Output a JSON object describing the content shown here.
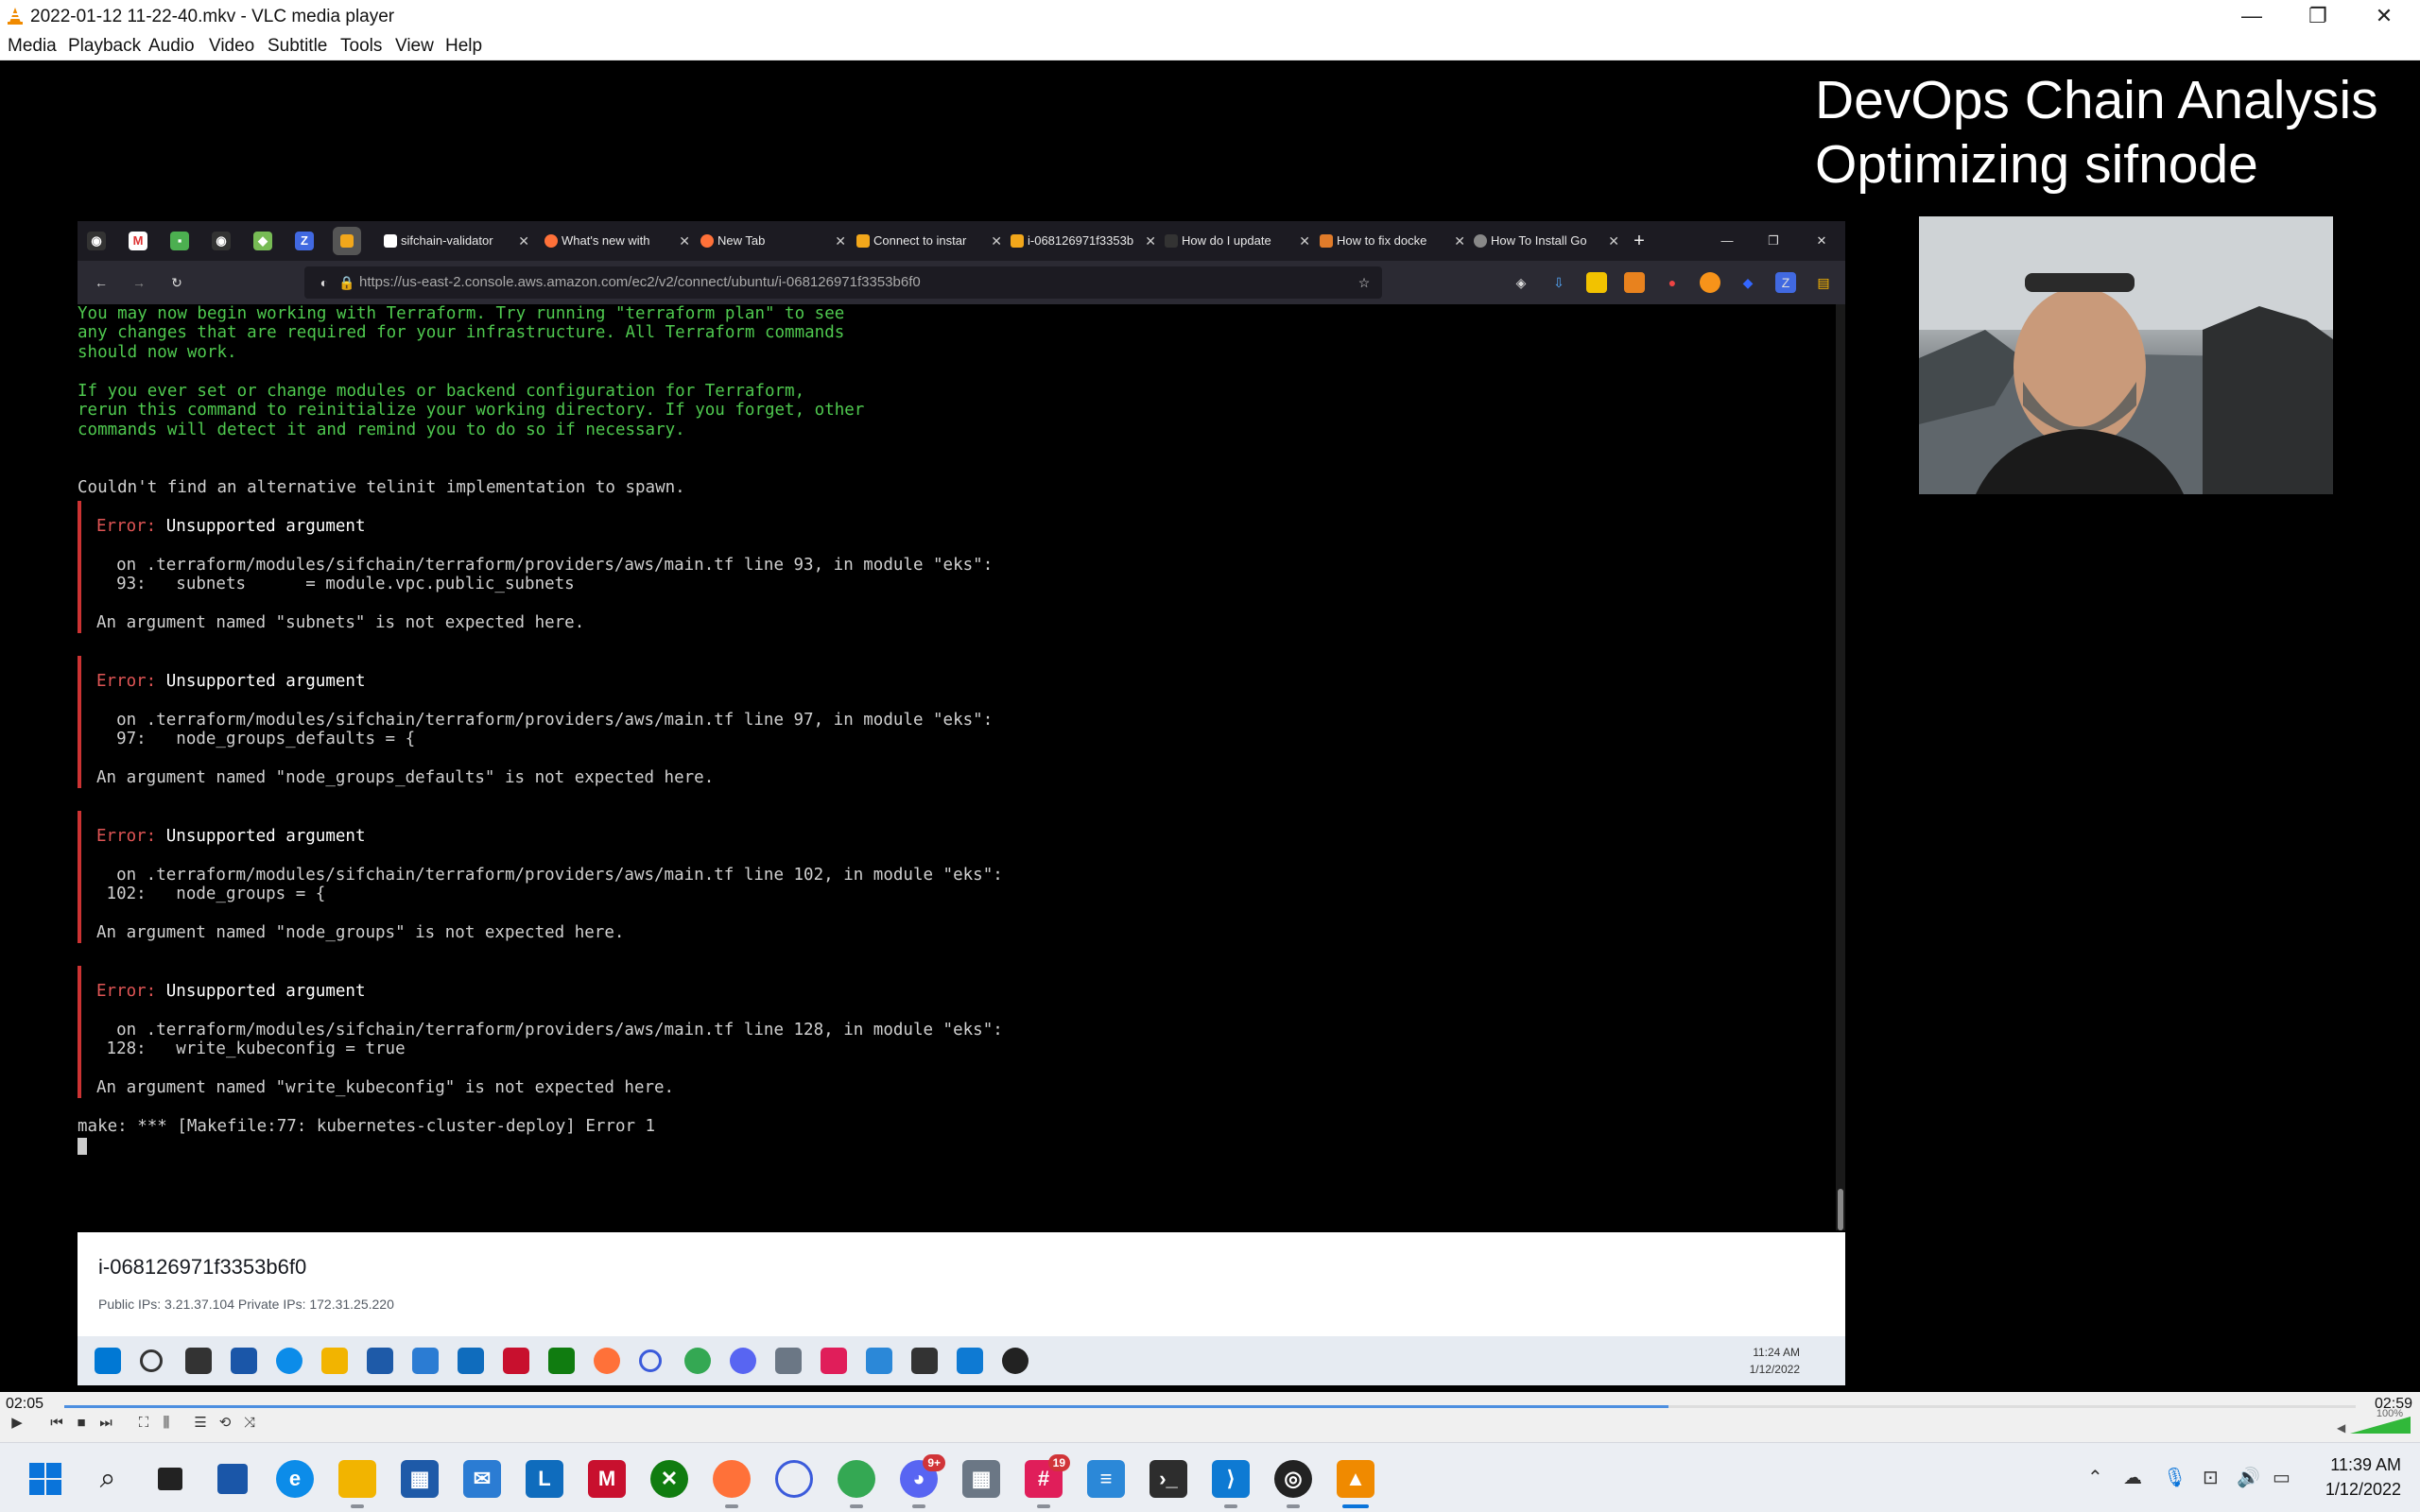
{
  "window": {
    "title": "2022-01-12 11-22-40.mkv - VLC media player",
    "minimize": "—",
    "restore": "❐",
    "close": "✕"
  },
  "menu": [
    "Media",
    "Playback",
    "Audio",
    "Video",
    "Subtitle",
    "Tools",
    "View",
    "Help"
  ],
  "slide": {
    "title_line1": "DevOps Chain Analysis",
    "title_line2": "Optimizing sifnode"
  },
  "browser": {
    "tabs": [
      {
        "label": "sifchain-validator",
        "color": "#ffffff"
      },
      {
        "label": "What's new with",
        "color": "#ff7139"
      },
      {
        "label": "New Tab",
        "color": "#ff7139"
      },
      {
        "label": "Connect to instar",
        "color": "#f2a71b"
      },
      {
        "label": "i-068126971f3353b",
        "color": "#f2a71b"
      },
      {
        "label": "How do I update",
        "color": "#333333"
      },
      {
        "label": "How to fix docke",
        "color": "#e07b2a"
      },
      {
        "label": "How To Install Go",
        "color": "#888888"
      }
    ],
    "new_tab": "+",
    "url": "https://us-east-2.console.aws.amazon.com/ec2/v2/connect/ubuntu/i-068126971f3353b6f0"
  },
  "terminal": {
    "intro": [
      "You may now begin working with Terraform. Try running \"terraform plan\" to see",
      "any changes that are required for your infrastructure. All Terraform commands",
      "should now work.",
      "",
      "If you ever set or change modules or backend configuration for Terraform,",
      "rerun this command to reinitialize your working directory. If you forget, other",
      "commands will detect it and remind you to do so if necessary."
    ],
    "telinit": "Couldn't find an alternative telinit implementation to spawn.",
    "errors": [
      {
        "label": "Error:",
        "title": "Unsupported argument",
        "location": "  on .terraform/modules/sifchain/terraform/providers/aws/main.tf line 93, in module \"eks\":",
        "code": "  93:   subnets      = module.vpc.public_subnets",
        "message": "An argument named \"subnets\" is not expected here."
      },
      {
        "label": "Error:",
        "title": "Unsupported argument",
        "location": "  on .terraform/modules/sifchain/terraform/providers/aws/main.tf line 97, in module \"eks\":",
        "code": "  97:   node_groups_defaults = {",
        "message": "An argument named \"node_groups_defaults\" is not expected here."
      },
      {
        "label": "Error:",
        "title": "Unsupported argument",
        "location": "  on .terraform/modules/sifchain/terraform/providers/aws/main.tf line 102, in module \"eks\":",
        "code": " 102:   node_groups = {",
        "message": "An argument named \"node_groups\" is not expected here."
      },
      {
        "label": "Error:",
        "title": "Unsupported argument",
        "location": "  on .terraform/modules/sifchain/terraform/providers/aws/main.tf line 128, in module \"eks\":",
        "code": " 128:   write_kubeconfig = true",
        "message": "An argument named \"write_kubeconfig\" is not expected here."
      }
    ],
    "make_error": "make: *** [Makefile:77: kubernetes-cluster-deploy] Error 1"
  },
  "aws": {
    "instance_id": "i-068126971f3353b6f0",
    "ips": "Public IPs: 3.21.37.104     Private IPs: 172.31.25.220"
  },
  "inner_clock": {
    "time": "11:24 AM",
    "date": "1/12/2022"
  },
  "player": {
    "elapsed": "02:05",
    "total": "02:59",
    "progress_fraction": 0.7,
    "volume": "100%"
  },
  "taskbar": {
    "time": "11:39 AM",
    "date": "1/12/2022",
    "discord_badge": "9+",
    "slack_badge": "19"
  }
}
